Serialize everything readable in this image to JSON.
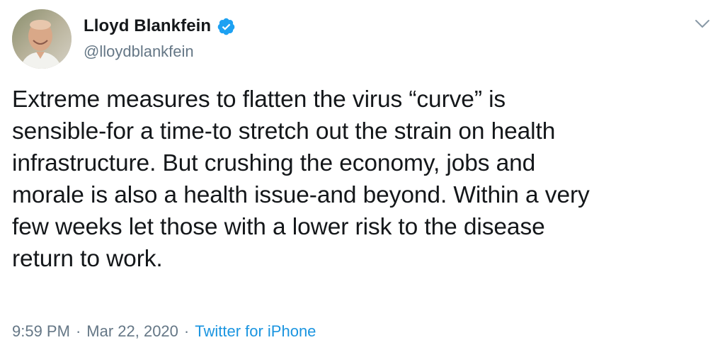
{
  "author": {
    "display_name": "Lloyd Blankfein",
    "handle": "@lloydblankfein",
    "verified": true
  },
  "tweet": {
    "text": "Extreme measures to flatten the virus “curve” is\nsensible-for a time-to stretch out the strain on health\ninfrastructure. But crushing the economy, jobs and\nmorale is also a health issue-and beyond. Within a very\nfew weeks let those with a lower risk to the disease\nreturn to work.",
    "time": "9:59 PM",
    "separator_1": "·",
    "date": "Mar 22, 2020",
    "separator_2": "·",
    "source": "Twitter for iPhone"
  },
  "icons": {
    "verified": "verified-badge-icon",
    "menu": "chevron-down-icon"
  },
  "colors": {
    "text": "#14171a",
    "secondary": "#657786",
    "link": "#1b95e0",
    "verified": "#1da1f2"
  }
}
